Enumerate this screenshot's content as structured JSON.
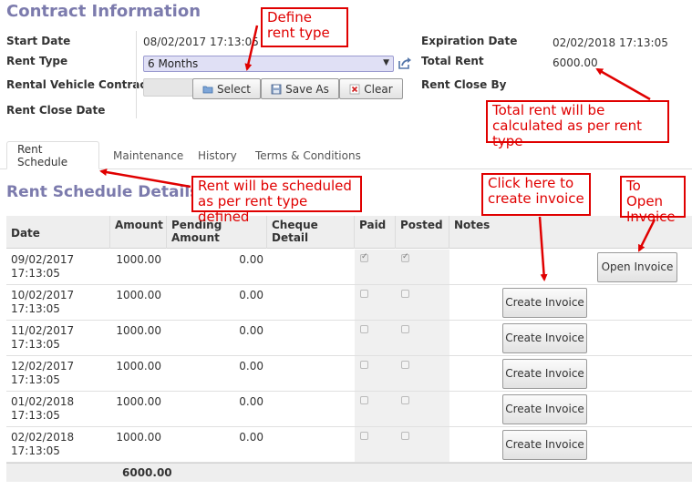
{
  "form": {
    "title": "Contract Information",
    "start_date_label": "Start Date",
    "start_date_value": "08/02/2017 17:13:05",
    "rent_type_label": "Rent Type",
    "rent_type_value": "6 Months",
    "rental_vehicle_label": "Rental Vehicle Contract",
    "rent_close_date_label": "Rent Close Date",
    "expiration_date_label": "Expiration Date",
    "expiration_date_value": "02/02/2018 17:13:05",
    "total_rent_label": "Total Rent",
    "total_rent_value": "6000.00",
    "rent_close_by_label": "Rent Close By",
    "buttons": {
      "select": "Select",
      "save_as": "Save As",
      "clear": "Clear"
    }
  },
  "tabs": [
    "Rent Schedule",
    "Maintenance",
    "History",
    "Terms & Conditions"
  ],
  "schedule": {
    "title": "Rent Schedule Details",
    "columns": [
      "Date",
      "Amount",
      "Pending Amount",
      "Cheque Detail",
      "Paid",
      "Posted",
      "Notes"
    ],
    "rows": [
      {
        "date": "09/02/2017",
        "time": "17:13:05",
        "amount": "1000.00",
        "pending": "0.00",
        "paid": true,
        "posted": true,
        "button": "Open Invoice"
      },
      {
        "date": "10/02/2017",
        "time": "17:13:05",
        "amount": "1000.00",
        "pending": "0.00",
        "paid": false,
        "posted": false,
        "button": "Create Invoice"
      },
      {
        "date": "11/02/2017",
        "time": "17:13:05",
        "amount": "1000.00",
        "pending": "0.00",
        "paid": false,
        "posted": false,
        "button": "Create Invoice"
      },
      {
        "date": "12/02/2017",
        "time": "17:13:05",
        "amount": "1000.00",
        "pending": "0.00",
        "paid": false,
        "posted": false,
        "button": "Create Invoice"
      },
      {
        "date": "01/02/2018",
        "time": "17:13:05",
        "amount": "1000.00",
        "pending": "0.00",
        "paid": false,
        "posted": false,
        "button": "Create Invoice"
      },
      {
        "date": "02/02/2018",
        "time": "17:13:05",
        "amount": "1000.00",
        "pending": "0.00",
        "paid": false,
        "posted": false,
        "button": "Create Invoice"
      }
    ],
    "total_amount": "6000.00"
  },
  "annotations": {
    "define_rent_type": "Define rent type",
    "total_rent_note": "Total rent will be calculated as per rent type",
    "schedule_note": "Rent will be scheduled as per rent type defined",
    "create_invoice_note": "Click here to create invoice",
    "open_invoice_note": "To Open Invoice"
  },
  "colors": {
    "accent": "#7c7bad",
    "annotation": "#e00000",
    "select_bg": "#e0e0f5"
  }
}
